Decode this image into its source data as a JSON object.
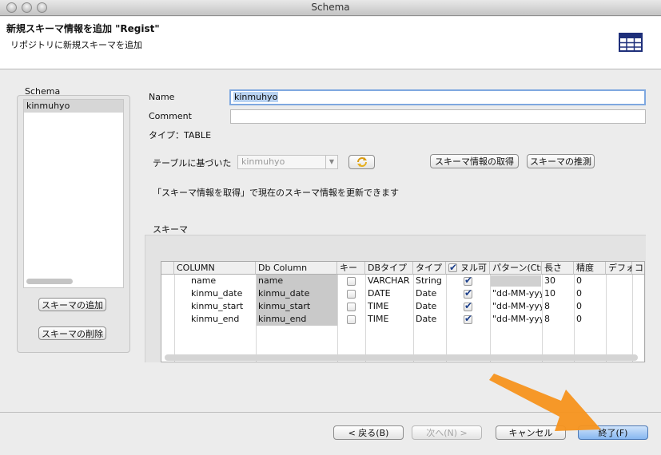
{
  "window": {
    "title": "Schema"
  },
  "header": {
    "title": "新規スキーマ情報を追加 \"Regist\"",
    "subtitle": "リポジトリに新規スキーマを追加",
    "icon": "table-icon"
  },
  "left": {
    "group_label": "Schema",
    "items": [
      "kinmuhyo"
    ],
    "add_button": "スキーマの追加",
    "delete_button": "スキーマの削除"
  },
  "form": {
    "name_label": "Name",
    "name_value": "kinmuhyo",
    "comment_label": "Comment",
    "comment_value": "",
    "type_label": "タイプ：TABLE",
    "based_on_label": "テーブルに基づいた",
    "based_on_value": "kinmuhyo",
    "refresh_icon": "refresh-icon",
    "get_schema_button": "スキーマ情報の取得",
    "guess_schema_button": "スキーマの推測",
    "hint": "「スキーマ情報を取得」で現在のスキーマ情報を更新できます"
  },
  "schema_table": {
    "group_label": "スキーマ",
    "columns": [
      "COLUMN",
      "Db Column",
      "キー",
      "DBタイプ",
      "タイプ",
      "ヌル可",
      "パターン(Ctrl+スペース)",
      "長さ",
      "精度",
      "デフォルト",
      "コメント"
    ],
    "rows": [
      {
        "column": "name",
        "db_column": "name",
        "key": false,
        "db_type": "VARCHAR",
        "type": "String",
        "nullable": true,
        "pattern": "",
        "length": "30",
        "precision": "0"
      },
      {
        "column": "kinmu_date",
        "db_column": "kinmu_date",
        "key": false,
        "db_type": "DATE",
        "type": "Date",
        "nullable": true,
        "pattern": "\"dd-MM-yyyy\"",
        "length": "10",
        "precision": "0"
      },
      {
        "column": "kinmu_start",
        "db_column": "kinmu_start",
        "key": false,
        "db_type": "TIME",
        "type": "Date",
        "nullable": true,
        "pattern": "\"dd-MM-yyyy\"",
        "length": "8",
        "precision": "0"
      },
      {
        "column": "kinmu_end",
        "db_column": "kinmu_end",
        "key": false,
        "db_type": "TIME",
        "type": "Date",
        "nullable": true,
        "pattern": "\"dd-MM-yyyy\"",
        "length": "8",
        "precision": "0"
      }
    ]
  },
  "footer": {
    "back": "< 戻る(B)",
    "next": "次へ(N) >",
    "cancel": "キャンセル",
    "finish": "終了(F)"
  },
  "colors": {
    "arrow": "#f7941d",
    "selection": "#b9d3f2",
    "primary_button": "#87b7f0"
  }
}
